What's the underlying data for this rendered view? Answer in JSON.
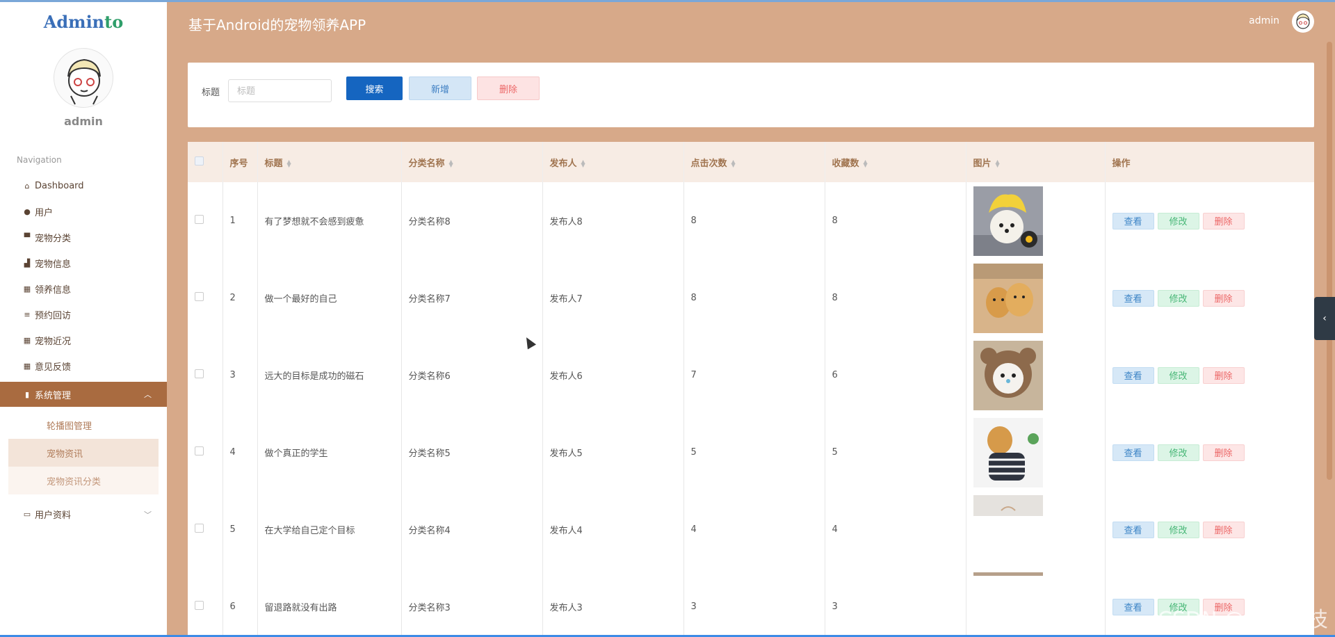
{
  "sidebar": {
    "logo": {
      "part1": "Admin",
      "part2": "to"
    },
    "username": "admin",
    "nav_header": "Navigation",
    "items": [
      {
        "label": "Dashboard",
        "icon": "home-icon"
      },
      {
        "label": "用户",
        "icon": "user-icon"
      },
      {
        "label": "宠物分类",
        "icon": "monitor-icon"
      },
      {
        "label": "宠物信息",
        "icon": "bar-chart-icon"
      },
      {
        "label": "领养信息",
        "icon": "grid-icon"
      },
      {
        "label": "预约回访",
        "icon": "list-icon"
      },
      {
        "label": "宠物近况",
        "icon": "grid-icon"
      },
      {
        "label": "意见反馈",
        "icon": "grid-icon"
      }
    ],
    "system": {
      "label": "系统管理",
      "sub_items": [
        "轮播图管理",
        "宠物资讯",
        "宠物资讯分类"
      ]
    },
    "user_info": {
      "label": "用户资料"
    }
  },
  "header": {
    "title": "基于Android的宠物领养APP",
    "user": "admin"
  },
  "search": {
    "label": "标题",
    "placeholder": "标题",
    "value": "",
    "btn_search": "搜索",
    "btn_add": "新增",
    "btn_delete": "删除"
  },
  "table": {
    "columns": [
      "序号",
      "标题",
      "分类名称",
      "发布人",
      "点击次数",
      "收藏数",
      "图片",
      "操作"
    ],
    "actions": {
      "view": "查看",
      "edit": "修改",
      "delete": "删除"
    },
    "rows": [
      {
        "no": "1",
        "title": "有了梦想就不会感到疲惫",
        "category": "分类名称8",
        "publisher": "发布人8",
        "clicks": "8",
        "favorites": "8"
      },
      {
        "no": "2",
        "title": "做一个最好的自己",
        "category": "分类名称7",
        "publisher": "发布人7",
        "clicks": "8",
        "favorites": "8"
      },
      {
        "no": "3",
        "title": "远大的目标是成功的磁石",
        "category": "分类名称6",
        "publisher": "发布人6",
        "clicks": "7",
        "favorites": "6"
      },
      {
        "no": "4",
        "title": "做个真正的学生",
        "category": "分类名称5",
        "publisher": "发布人5",
        "clicks": "5",
        "favorites": "5"
      },
      {
        "no": "5",
        "title": "在大学给自己定个目标",
        "category": "分类名称4",
        "publisher": "发布人4",
        "clicks": "4",
        "favorites": "4"
      },
      {
        "no": "6",
        "title": "留退路就没有出路",
        "category": "分类名称3",
        "publisher": "发布人3",
        "clicks": "3",
        "favorites": "3"
      }
    ]
  },
  "watermark": "CSDN @辉时科技"
}
